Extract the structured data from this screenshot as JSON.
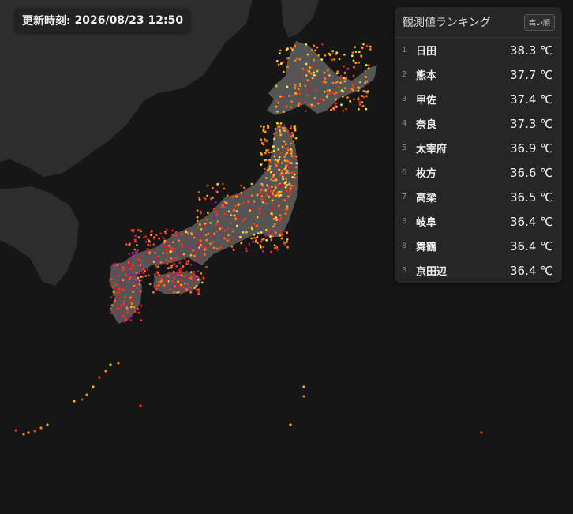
{
  "update": {
    "label": "更新時刻:",
    "datetime": "2026/08/23 12:50"
  },
  "ranking": {
    "title": "観測値ランキング",
    "sort_label": "高い順",
    "unit": "℃",
    "items": [
      {
        "rank": "1",
        "station": "日田",
        "value": "38.3 ℃"
      },
      {
        "rank": "2",
        "station": "熊本",
        "value": "37.7 ℃"
      },
      {
        "rank": "3",
        "station": "甲佐",
        "value": "37.4 ℃"
      },
      {
        "rank": "4",
        "station": "奈良",
        "value": "37.3 ℃"
      },
      {
        "rank": "5",
        "station": "太宰府",
        "value": "36.9 ℃"
      },
      {
        "rank": "6",
        "station": "枚方",
        "value": "36.6 ℃"
      },
      {
        "rank": "7",
        "station": "高梁",
        "value": "36.5 ℃"
      },
      {
        "rank": "8",
        "station": "岐阜",
        "value": "36.4 ℃"
      },
      {
        "rank": "8",
        "station": "舞鶴",
        "value": "36.4 ℃"
      },
      {
        "rank": "8",
        "station": "京田辺",
        "value": "36.4 ℃"
      }
    ]
  },
  "map": {
    "background_color": "#161616",
    "land_color": "#2d2d2d",
    "japan_land_color": "#555555",
    "marker_colors": [
      "#ffe23a",
      "#ffb020",
      "#ff7a1a",
      "#ee3a1a",
      "#d0182e",
      "#a0179a"
    ]
  }
}
